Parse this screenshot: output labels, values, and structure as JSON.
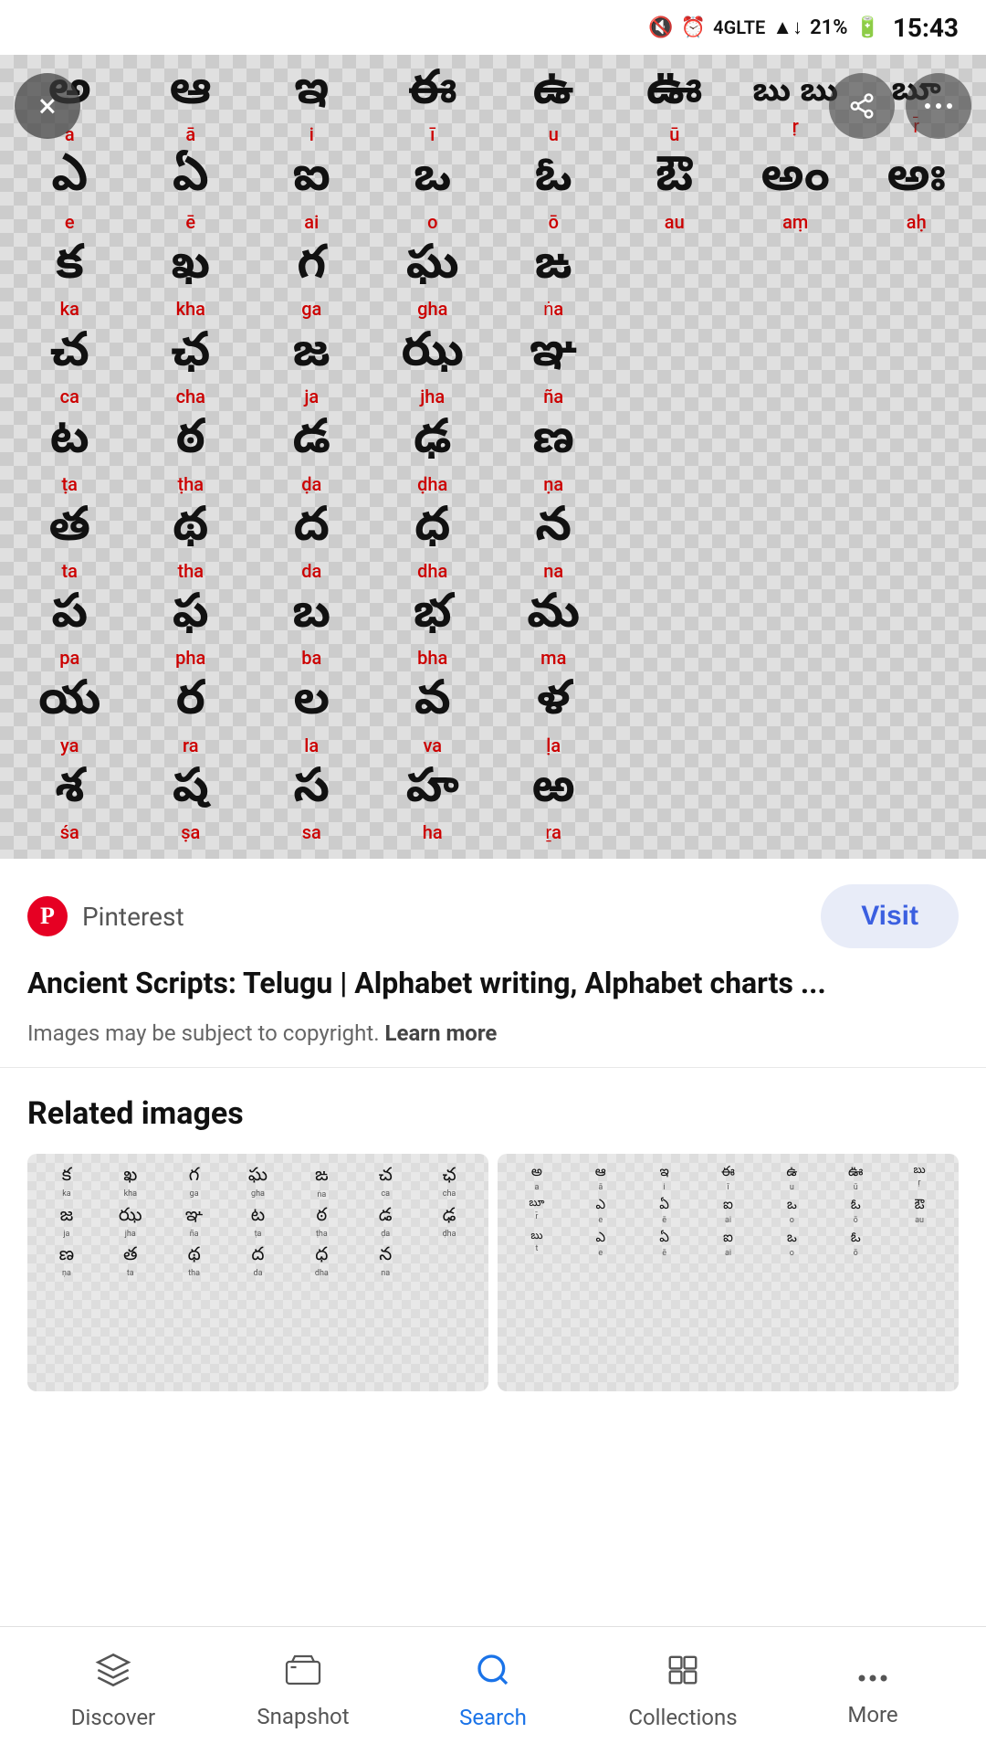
{
  "statusBar": {
    "icons": "🔇 ⏰ Vo)) 4G LTE ▲↓",
    "signal": "4G LTE",
    "battery": "21%",
    "time": "15:43"
  },
  "imageOverlay": {
    "closeBtn": "×",
    "shareBtn": "⊙",
    "dotsBtn": "⋯"
  },
  "teluguChart": {
    "vowels": [
      {
        "char": "అ",
        "roman": "a"
      },
      {
        "char": "ఆ",
        "roman": "ā"
      },
      {
        "char": "ఇ",
        "roman": "i"
      },
      {
        "char": "ఈ",
        "roman": "ī"
      },
      {
        "char": "ఉ",
        "roman": "u"
      },
      {
        "char": "ఊ",
        "roman": "ū"
      },
      {
        "char": "బు",
        "roman": "ṛ"
      },
      {
        "char": "బూ",
        "roman": "r̄"
      }
    ],
    "vowels2": [
      {
        "char": "ఎ",
        "roman": "e"
      },
      {
        "char": "ఏ",
        "roman": "ē"
      },
      {
        "char": "ఐ",
        "roman": "ai"
      },
      {
        "char": "ఒ",
        "roman": "o"
      },
      {
        "char": "ఓ",
        "roman": "ō"
      },
      {
        "char": "ఔ",
        "roman": "au"
      },
      {
        "char": "అం",
        "roman": "aṃ"
      },
      {
        "char": "అః",
        "roman": "aḥ"
      }
    ],
    "consonants": [
      {
        "char": "క",
        "roman": "ka"
      },
      {
        "char": "ఖ",
        "roman": "kha"
      },
      {
        "char": "గ",
        "roman": "ga"
      },
      {
        "char": "ఘ",
        "roman": "gha"
      },
      {
        "char": "ఙ",
        "roman": "ṅa"
      },
      {
        "char": "",
        "roman": ""
      },
      {
        "char": "",
        "roman": ""
      },
      {
        "char": "",
        "roman": ""
      }
    ],
    "row3": [
      {
        "char": "చ",
        "roman": "ca"
      },
      {
        "char": "ఛ",
        "roman": "cha"
      },
      {
        "char": "జ",
        "roman": "ja"
      },
      {
        "char": "ఝ",
        "roman": "jha"
      },
      {
        "char": "ఞ",
        "roman": "ña"
      },
      {
        "char": "",
        "roman": ""
      },
      {
        "char": "",
        "roman": ""
      },
      {
        "char": "",
        "roman": ""
      }
    ],
    "row4": [
      {
        "char": "ట",
        "roman": "ṭa"
      },
      {
        "char": "ఠ",
        "roman": "ṭha"
      },
      {
        "char": "డ",
        "roman": "ḍa"
      },
      {
        "char": "ఢ",
        "roman": "ḍha"
      },
      {
        "char": "ణ",
        "roman": "ṇa"
      },
      {
        "char": "",
        "roman": ""
      },
      {
        "char": "",
        "roman": ""
      },
      {
        "char": "",
        "roman": ""
      }
    ],
    "row5": [
      {
        "char": "త",
        "roman": "ta"
      },
      {
        "char": "థ",
        "roman": "tha"
      },
      {
        "char": "ద",
        "roman": "da"
      },
      {
        "char": "ధ",
        "roman": "dha"
      },
      {
        "char": "న",
        "roman": "na"
      },
      {
        "char": "",
        "roman": ""
      },
      {
        "char": "",
        "roman": ""
      },
      {
        "char": "",
        "roman": ""
      }
    ],
    "row6": [
      {
        "char": "ప",
        "roman": "pa"
      },
      {
        "char": "ఫ",
        "roman": "pha"
      },
      {
        "char": "బ",
        "roman": "ba"
      },
      {
        "char": "భ",
        "roman": "bha"
      },
      {
        "char": "మ",
        "roman": "ma"
      },
      {
        "char": "",
        "roman": ""
      },
      {
        "char": "",
        "roman": ""
      },
      {
        "char": "",
        "roman": ""
      }
    ],
    "row7": [
      {
        "char": "య",
        "roman": "ya"
      },
      {
        "char": "ర",
        "roman": "ra"
      },
      {
        "char": "ల",
        "roman": "la"
      },
      {
        "char": "వ",
        "roman": "va"
      },
      {
        "char": "ళ",
        "roman": "ḷa"
      },
      {
        "char": "",
        "roman": ""
      },
      {
        "char": "",
        "roman": ""
      },
      {
        "char": "",
        "roman": ""
      }
    ],
    "row8": [
      {
        "char": "శ",
        "roman": "śa"
      },
      {
        "char": "ష",
        "roman": "ṣa"
      },
      {
        "char": "స",
        "roman": "sa"
      },
      {
        "char": "హ",
        "roman": "ha"
      },
      {
        "char": "ఱ",
        "roman": "ṟa"
      },
      {
        "char": "",
        "roman": ""
      },
      {
        "char": "",
        "roman": ""
      },
      {
        "char": "",
        "roman": ""
      }
    ]
  },
  "infoSection": {
    "sourceName": "Pinterest",
    "pinterestLogo": "P",
    "visitLabel": "Visit",
    "title": "Ancient Scripts: Telugu | Alphabet writing, Alphabet charts ...",
    "copyright": "Images may be subject to copyright.",
    "learnMore": "Learn more"
  },
  "relatedSection": {
    "title": "Related images"
  },
  "bottomNav": {
    "items": [
      {
        "id": "discover",
        "label": "Discover",
        "icon": "✳",
        "active": false
      },
      {
        "id": "snapshot",
        "label": "Snapshot",
        "icon": "⬛",
        "active": false
      },
      {
        "id": "search",
        "label": "Search",
        "icon": "🔍",
        "active": true
      },
      {
        "id": "collections",
        "label": "Collections",
        "icon": "⬜",
        "active": false
      },
      {
        "id": "more",
        "label": "More",
        "icon": "•••",
        "active": false
      }
    ]
  }
}
